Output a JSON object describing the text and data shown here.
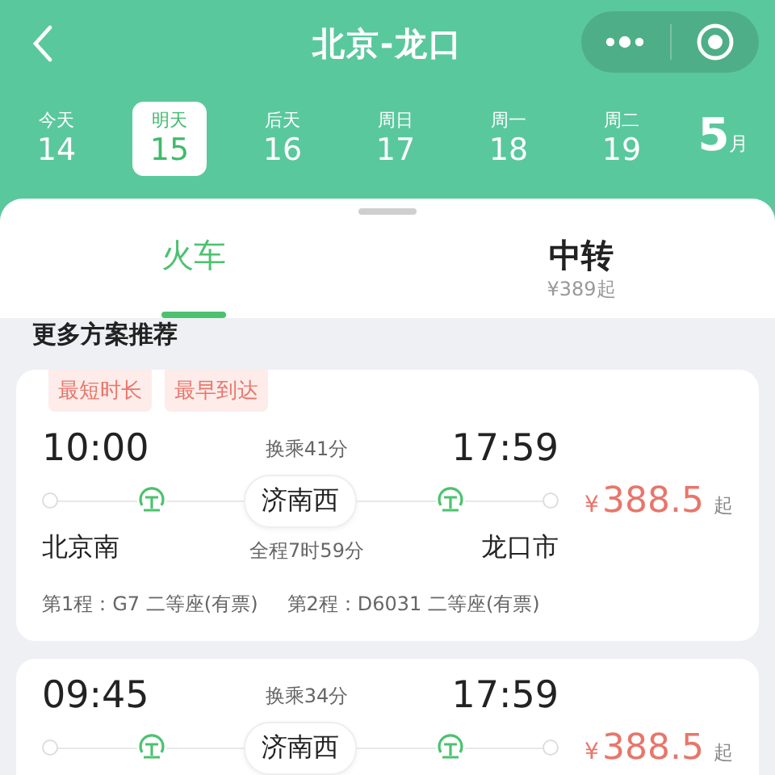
{
  "header": {
    "title": "北京-龙口"
  },
  "dates": [
    {
      "weekday": "今天",
      "day": "14",
      "selected": false
    },
    {
      "weekday": "明天",
      "day": "15",
      "selected": true
    },
    {
      "weekday": "后天",
      "day": "16",
      "selected": false
    },
    {
      "weekday": "周日",
      "day": "17",
      "selected": false
    },
    {
      "weekday": "周一",
      "day": "18",
      "selected": false
    },
    {
      "weekday": "周二",
      "day": "19",
      "selected": false
    }
  ],
  "month": {
    "number": "5",
    "unit": "月"
  },
  "tabs": [
    {
      "label": "火车",
      "selected": true
    },
    {
      "label": "中转",
      "sub": "¥389起",
      "selected": false
    }
  ],
  "section_title": "更多方案推荐",
  "routes": [
    {
      "tags": [
        "最短时长",
        "最早到达"
      ],
      "depart_time": "10:00",
      "transfer": "换乘41分",
      "arrive_time": "17:59",
      "via": "济南西",
      "from": "北京南",
      "duration": "全程7时59分",
      "to": "龙口市",
      "price_symbol": "¥",
      "price": "388.5",
      "price_suffix": "起",
      "legs": [
        "第1程：G7 二等座(有票)",
        "第2程：D6031 二等座(有票)"
      ]
    },
    {
      "depart_time": "09:45",
      "transfer": "换乘34分",
      "arrive_time": "17:59",
      "via": "济南西",
      "price_symbol": "¥",
      "price": "388.5",
      "price_suffix": "起"
    }
  ]
}
